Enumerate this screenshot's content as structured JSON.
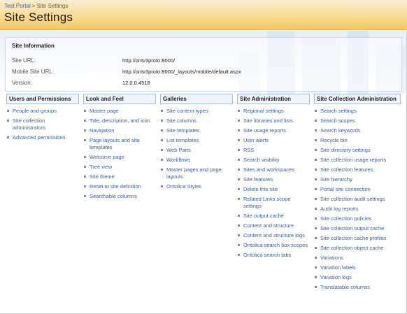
{
  "breadcrumb": {
    "root": "Test Portal",
    "separator": ">",
    "current": "Site Settings"
  },
  "page_title": "Site Settings",
  "site_info": {
    "title": "Site Information",
    "rows": [
      {
        "label": "Site URL:",
        "value": "http://ontv3proto:8000/"
      },
      {
        "label": "Mobile Site URL:",
        "value": "http://ontv3proto:8000/_layouts/mobile/default.aspx"
      },
      {
        "label": "Version:",
        "value": "12.0.0.4518"
      }
    ]
  },
  "columns": [
    {
      "title": "Users and Permissions",
      "items": [
        "People and groups",
        "Site collection administrators",
        "Advanced permissions"
      ]
    },
    {
      "title": "Look and Feel",
      "items": [
        "Master page",
        "Title, description, and icon",
        "Navigation",
        "Page layouts and site templates",
        "Welcome page",
        "Tree view",
        "Site theme",
        "Reset to site definition",
        "Searchable columns"
      ]
    },
    {
      "title": "Galleries",
      "items": [
        "Site content types",
        "Site columns",
        "Site templates",
        "List templates",
        "Web Parts",
        "Workflows",
        "Master pages and page layouts",
        "Ontolica Styles"
      ]
    },
    {
      "title": "Site Administration",
      "items": [
        "Regional settings",
        "Site libraries and lists",
        "Site usage reports",
        "User alerts",
        "RSS",
        "Search visibility",
        "Sites and workspaces",
        "Site features",
        "Delete this site",
        "Related Links scope settings",
        "Site output cache",
        "Content and structure",
        "Content and structure logs",
        "Ontolica search box scopes",
        "Ontolica search tabs"
      ]
    },
    {
      "title": "Site Collection Administration",
      "items": [
        "Search settings",
        "Search scopes",
        "Search keywords",
        "Recycle bin",
        "Site directory settings",
        "Site collection usage reports",
        "Site collection features",
        "Site hierarchy",
        "Portal site connection",
        "Site collection audit settings",
        "Audit log reports",
        "Site collection policies",
        "Site collection output cache",
        "Site collection cache profiles",
        "Site collection object cache",
        "Variations",
        "Variation labels",
        "Variation logs",
        "Translatable columns"
      ]
    }
  ]
}
